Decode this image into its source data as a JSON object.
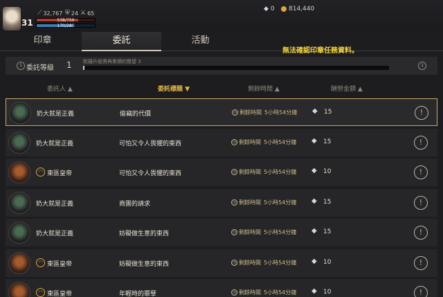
{
  "player": {
    "level": "31",
    "stat1": "32,767",
    "stat2": "24",
    "stat3": "65",
    "hp": "538/750",
    "mp": "170/280",
    "hp_fraction": 0.72,
    "mp_fraction": 0.62
  },
  "currency": {
    "gems": "0",
    "gold": "814,440"
  },
  "tabs": [
    {
      "label": "印章"
    },
    {
      "label": "委託"
    },
    {
      "label": "活動"
    }
  ],
  "notice": "無法確認印章任務資料。",
  "commission_level": {
    "label": "委託等級",
    "value": "1",
    "hint": "距離升級需再累積的聲望 3",
    "badge": "1"
  },
  "columns": {
    "client": "委託人 ▲",
    "title": "委託標題 ▼",
    "time": "剩餘時間 ▲",
    "reward": "酬勞金額 ▲"
  },
  "rows": [
    {
      "client": "奶大就是正義",
      "guild": false,
      "title": "偷竊的代價",
      "time_label": "剩餘時間",
      "time": "5小時54分鐘",
      "amount": "15"
    },
    {
      "client": "奶大就是正義",
      "guild": false,
      "title": "可怕又令人畏懼的東西",
      "time_label": "剩餘時間",
      "time": "5小時54分鐘",
      "amount": "15"
    },
    {
      "client": "東區皇帝",
      "guild": true,
      "title": "可怕又令人畏懼的東西",
      "time_label": "剩餘時間",
      "time": "5小時54分鐘",
      "amount": "10"
    },
    {
      "client": "奶大就是正義",
      "guild": false,
      "title": "商團的請求",
      "time_label": "剩餘時間",
      "time": "5小時54分鐘",
      "amount": "15"
    },
    {
      "client": "奶大就是正義",
      "guild": false,
      "title": "妨礙做生意的東西",
      "time_label": "剩餘時間",
      "time": "5小時54分鐘",
      "amount": "15"
    },
    {
      "client": "東區皇帝",
      "guild": true,
      "title": "妨礙做生意的東西",
      "time_label": "剩餘時間",
      "time": "5小時54分鐘",
      "amount": "10"
    },
    {
      "client": "東區皇帝",
      "guild": true,
      "title": "年輕時的罪孽",
      "time_label": "剩餘時間",
      "time": "5小時54分鐘",
      "amount": "10"
    }
  ],
  "icons": {
    "gem": "diamond-icon",
    "gold": "gold-coin-icon",
    "clock": "clock-icon",
    "info": "exclamation-circle-icon"
  }
}
